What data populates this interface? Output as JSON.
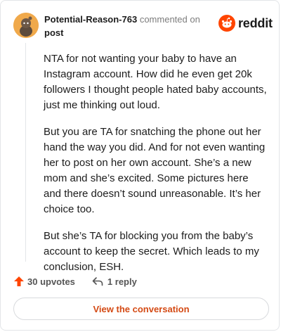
{
  "header": {
    "username": "Potential-Reason-763",
    "action_text": "commented on",
    "post_link": "post"
  },
  "brand": {
    "name": "reddit",
    "color": "#ff4500"
  },
  "comment": {
    "paragraphs": [
      "NTA for not wanting your baby to have an Instagram account. How did he even get 20k followers I thought people hated baby accounts, just me thinking out loud.",
      "But you are TA for snatching the phone out her hand the way you did. And for not even wanting her to post on her own account. She’s a new mom and she’s excited. Some pictures here and there doesn’t sound unreasonable. It’s her choice too.",
      "But she’s TA for blocking you from the baby’s account to keep the secret. Which leads to my conclusion, ESH."
    ]
  },
  "footer": {
    "upvotes": "30 upvotes",
    "replies": "1 reply"
  },
  "actions": {
    "view_conversation": "View the conversation"
  },
  "icons": [
    "avatar-icon",
    "reddit-logo-icon",
    "upvote-arrow-icon",
    "reply-arrow-icon"
  ]
}
